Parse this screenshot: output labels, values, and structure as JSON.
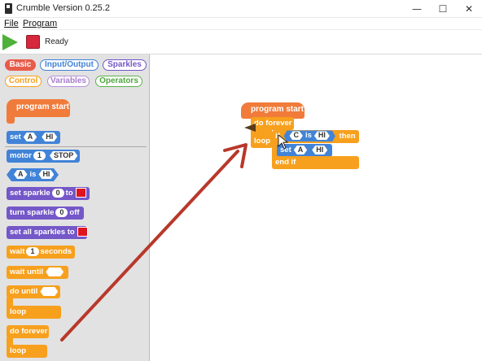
{
  "window": {
    "title": "Crumble Version 0.25.2",
    "minimize": "—",
    "maximize": "☐",
    "close": "✕"
  },
  "menu": {
    "file": "File",
    "program": "Program"
  },
  "toolbar": {
    "status": "Ready"
  },
  "categories": {
    "basic": "Basic",
    "io": "Input/Output",
    "sparkles": "Sparkles",
    "control": "Control",
    "variables": "Variables",
    "operators": "Operators"
  },
  "palette": {
    "program_start": "program start",
    "set": "set",
    "set_pin": "A",
    "set_val": "HI",
    "motor": "motor",
    "motor_num": "1",
    "motor_state": "STOP",
    "is_pin": "A",
    "is": "is",
    "is_val": "HI",
    "set_sparkle": "set sparkle",
    "set_sparkle_num": "0",
    "set_sparkle_to": "to",
    "turn_sparkle": "turn sparkle",
    "turn_sparkle_num": "0",
    "turn_sparkle_off": "off",
    "set_all_sparkles": "set all sparkles to",
    "wait": "wait",
    "wait_num": "1",
    "wait_seconds": "seconds",
    "wait_until": "wait until",
    "do_until": "do until",
    "loop1": "loop",
    "do_forever": "do forever",
    "loop2": "loop"
  },
  "script": {
    "program_start": "program start",
    "do_forever": "do forever",
    "loop": "loop",
    "if": "if",
    "if_pin": "C",
    "is": "is",
    "if_val": "HI",
    "then": "then",
    "set": "set",
    "set_pin": "A",
    "set_val": "HI",
    "end_if": "end if"
  },
  "colors": {
    "hat": "#f07b3a",
    "control": "#f7a01d",
    "io": "#4183d7",
    "sparkle": "#7457c8",
    "arrow": "#b8382b",
    "play": "#4fb03a",
    "stop": "#d6273d"
  }
}
